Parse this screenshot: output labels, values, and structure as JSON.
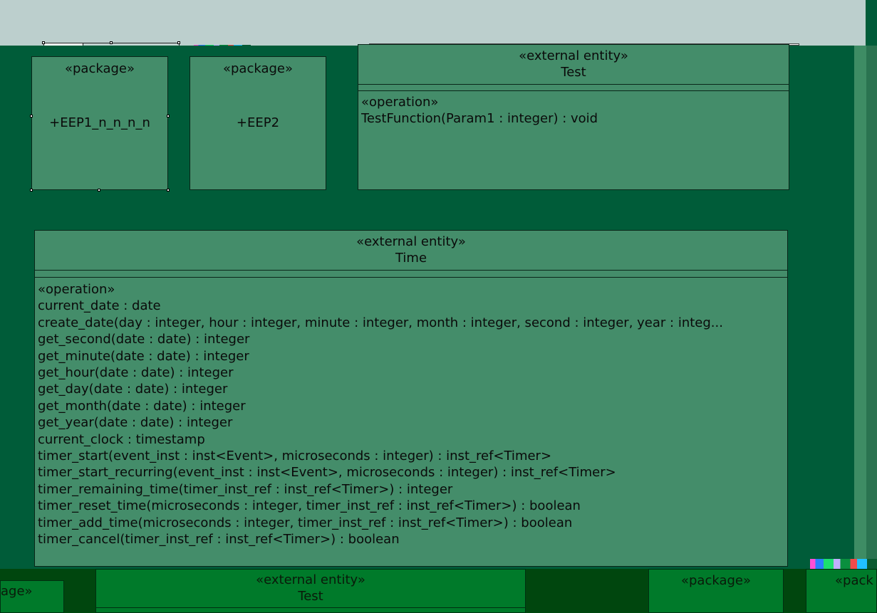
{
  "diagram": {
    "packages": [
      {
        "stereotype": "«package»",
        "name": "+EEP1_n_n_n_n"
      },
      {
        "stereotype": "«package»",
        "name": "+EEP2"
      }
    ],
    "test_entity": {
      "stereotype": "«external entity»",
      "name": "Test",
      "operations_header": "«operation»",
      "operations": [
        "TestFunction(Param1 : integer) : void"
      ]
    },
    "time_entity": {
      "stereotype": "«external entity»",
      "name": "Time",
      "operations_header": "«operation»",
      "operations": [
        "current_date : date",
        "create_date(day : integer, hour : integer, minute : integer, month : integer, second : integer, year : integ...",
        "get_second(date : date) : integer",
        "get_minute(date : date) : integer",
        "get_hour(date : date) : integer",
        "get_day(date : date) : integer",
        "get_month(date : date) : integer",
        "get_year(date : date) : integer",
        "current_clock : timestamp",
        "timer_start(event_inst : inst<Event>, microseconds : integer) : inst_ref<Timer>",
        "timer_start_recurring(event_inst : inst<Event>, microseconds : integer) : inst_ref<Timer>",
        "timer_remaining_time(timer_inst_ref : inst_ref<Timer>) : integer",
        "timer_reset_time(microseconds : integer, timer_inst_ref : inst_ref<Timer>) : boolean",
        "timer_add_time(microseconds : integer, timer_inst_ref : inst_ref<Timer>) : boolean",
        "timer_cancel(timer_inst_ref : inst_ref<Timer>) : boolean"
      ]
    }
  },
  "overview_strip": {
    "left_fragment": "age»",
    "entity_stereotype": "«external entity»",
    "entity_name": "Test",
    "package_stereotype": "«package»",
    "right_fragment": "«pack"
  },
  "colors": {
    "canvas": "#005c39",
    "element_fill": "#448d6a",
    "toolbar": "#bccfcd"
  }
}
